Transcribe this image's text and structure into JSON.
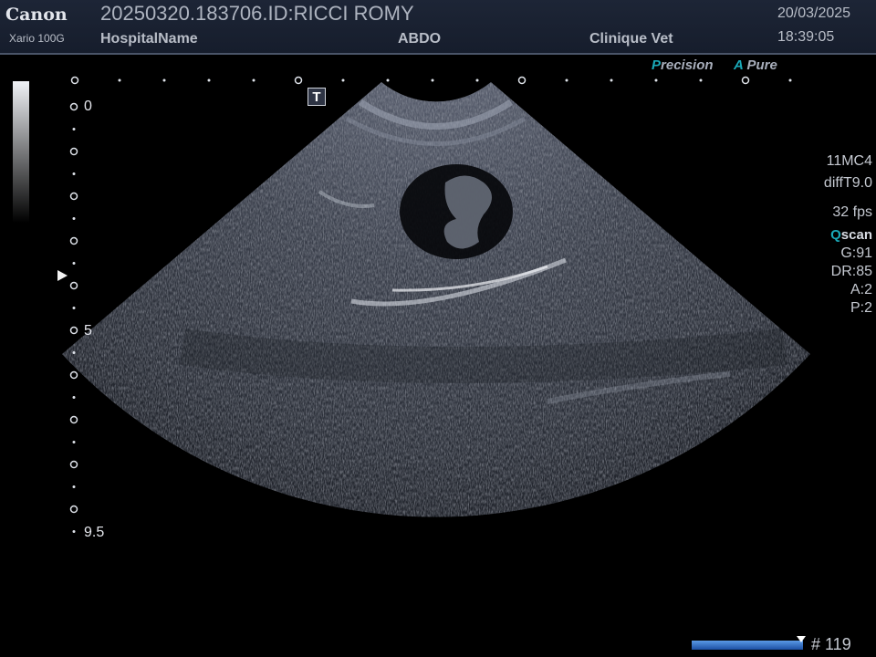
{
  "header": {
    "brand": "Canon",
    "model": "Xario 100G",
    "patient_id": "20250320.183706.ID:RICCI ROMY",
    "hospital": "HospitalName",
    "preset": "ABDO",
    "clinic": "Clinique Vet",
    "date": "20/03/2025",
    "time": "18:39:05"
  },
  "processing": {
    "precision_accent": "P",
    "precision_rest": "recision",
    "apure_accent": "A",
    "apure_rest": "Pure"
  },
  "depth_scale": {
    "top": "0",
    "mid": "5",
    "bottom": "9.5"
  },
  "tgc_button": "T",
  "imaging_params": {
    "probe": "11MC4",
    "mode": "diffT9.0",
    "frame_rate": "32 fps",
    "qscan_accent": "Q",
    "qscan_rest": "scan",
    "gain": "G:91",
    "dynamic_range": "DR:85",
    "a": "A:2",
    "p": "P:2"
  },
  "cine": {
    "frame_label": "# 119"
  },
  "colors": {
    "accent": "#1aa9b8",
    "header_bg": "#1d2536",
    "cine_bar": "#3f7fd4"
  }
}
